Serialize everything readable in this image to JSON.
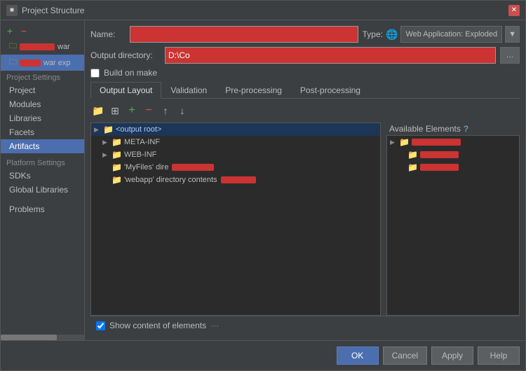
{
  "titleBar": {
    "title": "Project Structure",
    "closeLabel": "✕",
    "appIcon": "■"
  },
  "sidebar": {
    "toolbar": {
      "addLabel": "+",
      "removeLabel": "−"
    },
    "projectSettingsLabel": "Project Settings",
    "items": [
      {
        "id": "project",
        "label": "Project"
      },
      {
        "id": "modules",
        "label": "Modules"
      },
      {
        "id": "libraries",
        "label": "Libraries"
      },
      {
        "id": "facets",
        "label": "Facets"
      },
      {
        "id": "artifacts",
        "label": "Artifacts",
        "active": true
      }
    ],
    "platformLabel": "Platform Settings",
    "platformItems": [
      {
        "id": "sdks",
        "label": "SDKs"
      },
      {
        "id": "global-libraries",
        "label": "Global Libraries"
      }
    ],
    "otherItems": [
      {
        "id": "problems",
        "label": "Problems"
      }
    ],
    "artifacts": [
      {
        "id": "artifact-war",
        "label": "war",
        "selected": false
      },
      {
        "id": "artifact-war-exp",
        "label": "war exp",
        "selected": true
      }
    ]
  },
  "rightPanel": {
    "nameLabel": "Name:",
    "namePlaceholder": "",
    "typeLabel": "Type:",
    "typeValue": "Web Application: Exploded",
    "outputDirLabel": "Output directory:",
    "outputDirValue": "D:\\Co",
    "buildOnMake": "Build on make",
    "tabs": [
      {
        "id": "output-layout",
        "label": "Output Layout",
        "active": true
      },
      {
        "id": "validation",
        "label": "Validation"
      },
      {
        "id": "pre-processing",
        "label": "Pre-processing"
      },
      {
        "id": "post-processing",
        "label": "Post-processing"
      }
    ],
    "treeToolbar": {
      "addBtn": "+",
      "removeBtn": "−",
      "moveUpBtn": "↑",
      "moveDownBtn": "↓",
      "folderBtn": "📁"
    },
    "treeItems": [
      {
        "id": "output-root",
        "label": "<output root>",
        "level": 0,
        "expanded": true,
        "isRoot": true
      },
      {
        "id": "meta-inf",
        "label": "META-INF",
        "level": 1,
        "expanded": true
      },
      {
        "id": "web-inf",
        "label": "WEB-INF",
        "level": 1,
        "expanded": false
      },
      {
        "id": "myfiles-dir",
        "label": "'MyFiles' dire",
        "level": 1,
        "hasRedacted": true
      },
      {
        "id": "webapp-dir",
        "label": "'webapp' directory contents",
        "level": 1,
        "hasRedacted": true
      }
    ],
    "availableLabel": "Available Elements",
    "availableHelpIcon": "?",
    "availableItems": [
      {
        "id": "avail-1",
        "level": 0,
        "expanded": true,
        "hasRedacted": true
      },
      {
        "id": "avail-2",
        "level": 1,
        "hasRedacted": true
      },
      {
        "id": "avail-3",
        "level": 1,
        "hasRedacted": true
      }
    ],
    "showContentLabel": "Show content of elements",
    "showContentChecked": true
  },
  "footer": {
    "okLabel": "OK",
    "cancelLabel": "Cancel",
    "applyLabel": "Apply",
    "helpLabel": "Help"
  }
}
